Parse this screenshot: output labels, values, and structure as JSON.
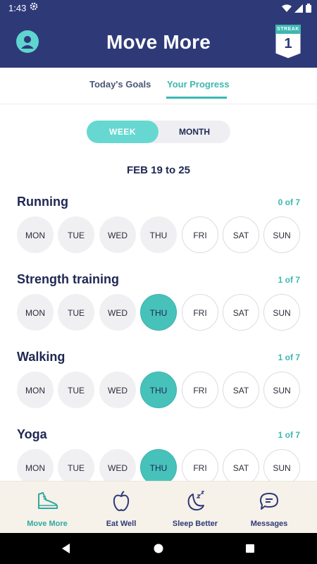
{
  "status": {
    "time": "1:43"
  },
  "header": {
    "title": "Move More",
    "streak_label": "STREAK",
    "streak_value": "1"
  },
  "tabs": [
    {
      "label": "Today's Goals",
      "active": false
    },
    {
      "label": "Your Progress",
      "active": true
    }
  ],
  "toggle": {
    "week": "WEEK",
    "month": "MONTH",
    "selected": "WEEK"
  },
  "date_range": "FEB 19 to 25",
  "days": [
    "MON",
    "TUE",
    "WED",
    "THU",
    "FRI",
    "SAT",
    "SUN"
  ],
  "goals": [
    {
      "name": "Running",
      "count": "0 of 7",
      "completed": [
        false,
        false,
        false,
        false,
        false,
        false,
        false
      ]
    },
    {
      "name": "Strength training",
      "count": "1 of 7",
      "completed": [
        false,
        false,
        false,
        true,
        false,
        false,
        false
      ]
    },
    {
      "name": "Walking",
      "count": "1 of 7",
      "completed": [
        false,
        false,
        false,
        true,
        false,
        false,
        false
      ]
    },
    {
      "name": "Yoga",
      "count": "1 of 7",
      "completed": [
        false,
        false,
        false,
        true,
        false,
        false,
        false
      ]
    }
  ],
  "bottom_nav": [
    {
      "label": "Move More",
      "icon": "shoe-icon",
      "active": true
    },
    {
      "label": "Eat Well",
      "icon": "apple-icon",
      "active": false
    },
    {
      "label": "Sleep Better",
      "icon": "moon-icon",
      "active": false
    },
    {
      "label": "Messages",
      "icon": "chat-bubble-icon",
      "active": false
    }
  ],
  "colors": {
    "header_bg": "#2e3a78",
    "accent": "#3bb8b1",
    "completed_day": "#47c2bb",
    "nav_bg": "#f6f1e9"
  }
}
